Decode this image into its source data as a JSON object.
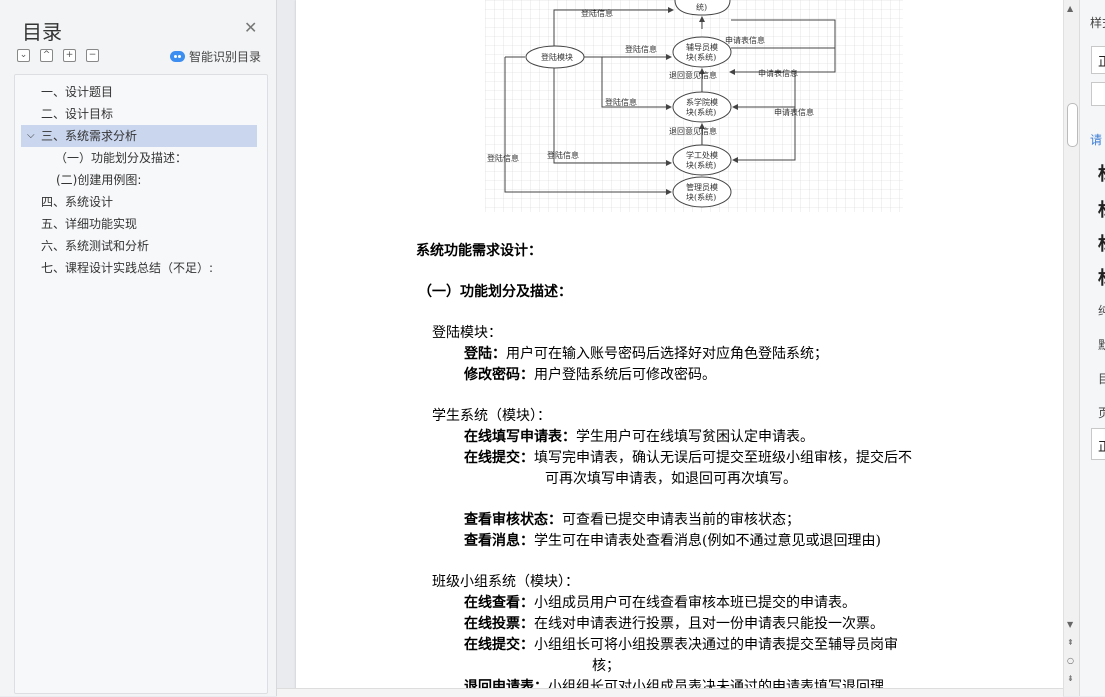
{
  "toc": {
    "title": "目录",
    "smart_label": "智能识别目录",
    "tool_expand": "⌄",
    "tool_collapse": "^",
    "tool_add": "+",
    "tool_remove": "−",
    "items": [
      {
        "label": "一、设计题目"
      },
      {
        "label": "二、设计目标"
      },
      {
        "label": "三、系统需求分析"
      },
      {
        "label": "（一）功能划分及描述："
      },
      {
        "label": "(二)创建用例图:"
      },
      {
        "label": "四、系统设计"
      },
      {
        "label": "五、详细功能实现"
      },
      {
        "label": "六、系统测试和分析"
      },
      {
        "label": "七、课程设计实践总结（不足）:"
      }
    ]
  },
  "diagram": {
    "login_module": "登陆模块",
    "counselor_1": "辅导员模",
    "counselor_2": "块(系统)",
    "college_1": "系学院模",
    "college_2": "块(系统)",
    "affairs_1": "学工处模",
    "affairs_2": "块(系统)",
    "admin_1": "管理员模",
    "admin_2": "块(系统)",
    "top_2": "统)",
    "login_info": "登陆信息",
    "application_info": "申请表信息",
    "return_opinion": "退回意见信息"
  },
  "doc": {
    "h_requirements": "系统功能需求设计：",
    "h_section1": "（一）功能划分及描述：",
    "login_module_title": "登陆模块：",
    "login_label": "登陆：",
    "login_text": "用户可在输入账号密码后选择好对应角色登陆系统；",
    "change_pw_label": "修改密码：",
    "change_pw_text": "用户登陆系统后可修改密码。",
    "student_title": "学生系统（模块）：",
    "fill_label": "在线填写申请表：",
    "fill_text": "学生用户可在线填写贫困认定申请表。",
    "submit_label": "在线提交：",
    "submit_text": "填写完申请表，确认无误后可提交至班级小组审核，提交后不",
    "submit_text2": "可再次填写申请表，如退回可再次填写。",
    "status_label": "查看审核状态：",
    "status_text": "可查看已提交申请表当前的审核状态；",
    "msg_label": "查看消息：",
    "msg_text": "学生可在申请表处查看消息(例如不通过意见或退回理由)",
    "class_title": "班级小组系统（模块）：",
    "view_label": "在线查看：",
    "view_text": "小组成员用户可在线查看审核本班已提交的申请表。",
    "vote_label": "在线投票：",
    "vote_text": "在线对申请表进行投票，且对一份申请表只能投一次票。",
    "submit2_label": "在线提交：",
    "submit2_text": "小组组长可将小组投票表决通过的申请表提交至辅导员岗审",
    "submit2_text2": "核；",
    "return_label": "退回申请表：",
    "return_text": "小组组长可对小组成员表决未通过的申请表填写退回理"
  },
  "right_panel": {
    "style_label": "样式",
    "body_label": "正",
    "hint_label": "请",
    "big_glyphs": [
      "标",
      "标",
      "标",
      "标"
    ],
    "small_glyphs": [
      "纯",
      "默",
      "目",
      "页"
    ],
    "body_label2": "正"
  }
}
